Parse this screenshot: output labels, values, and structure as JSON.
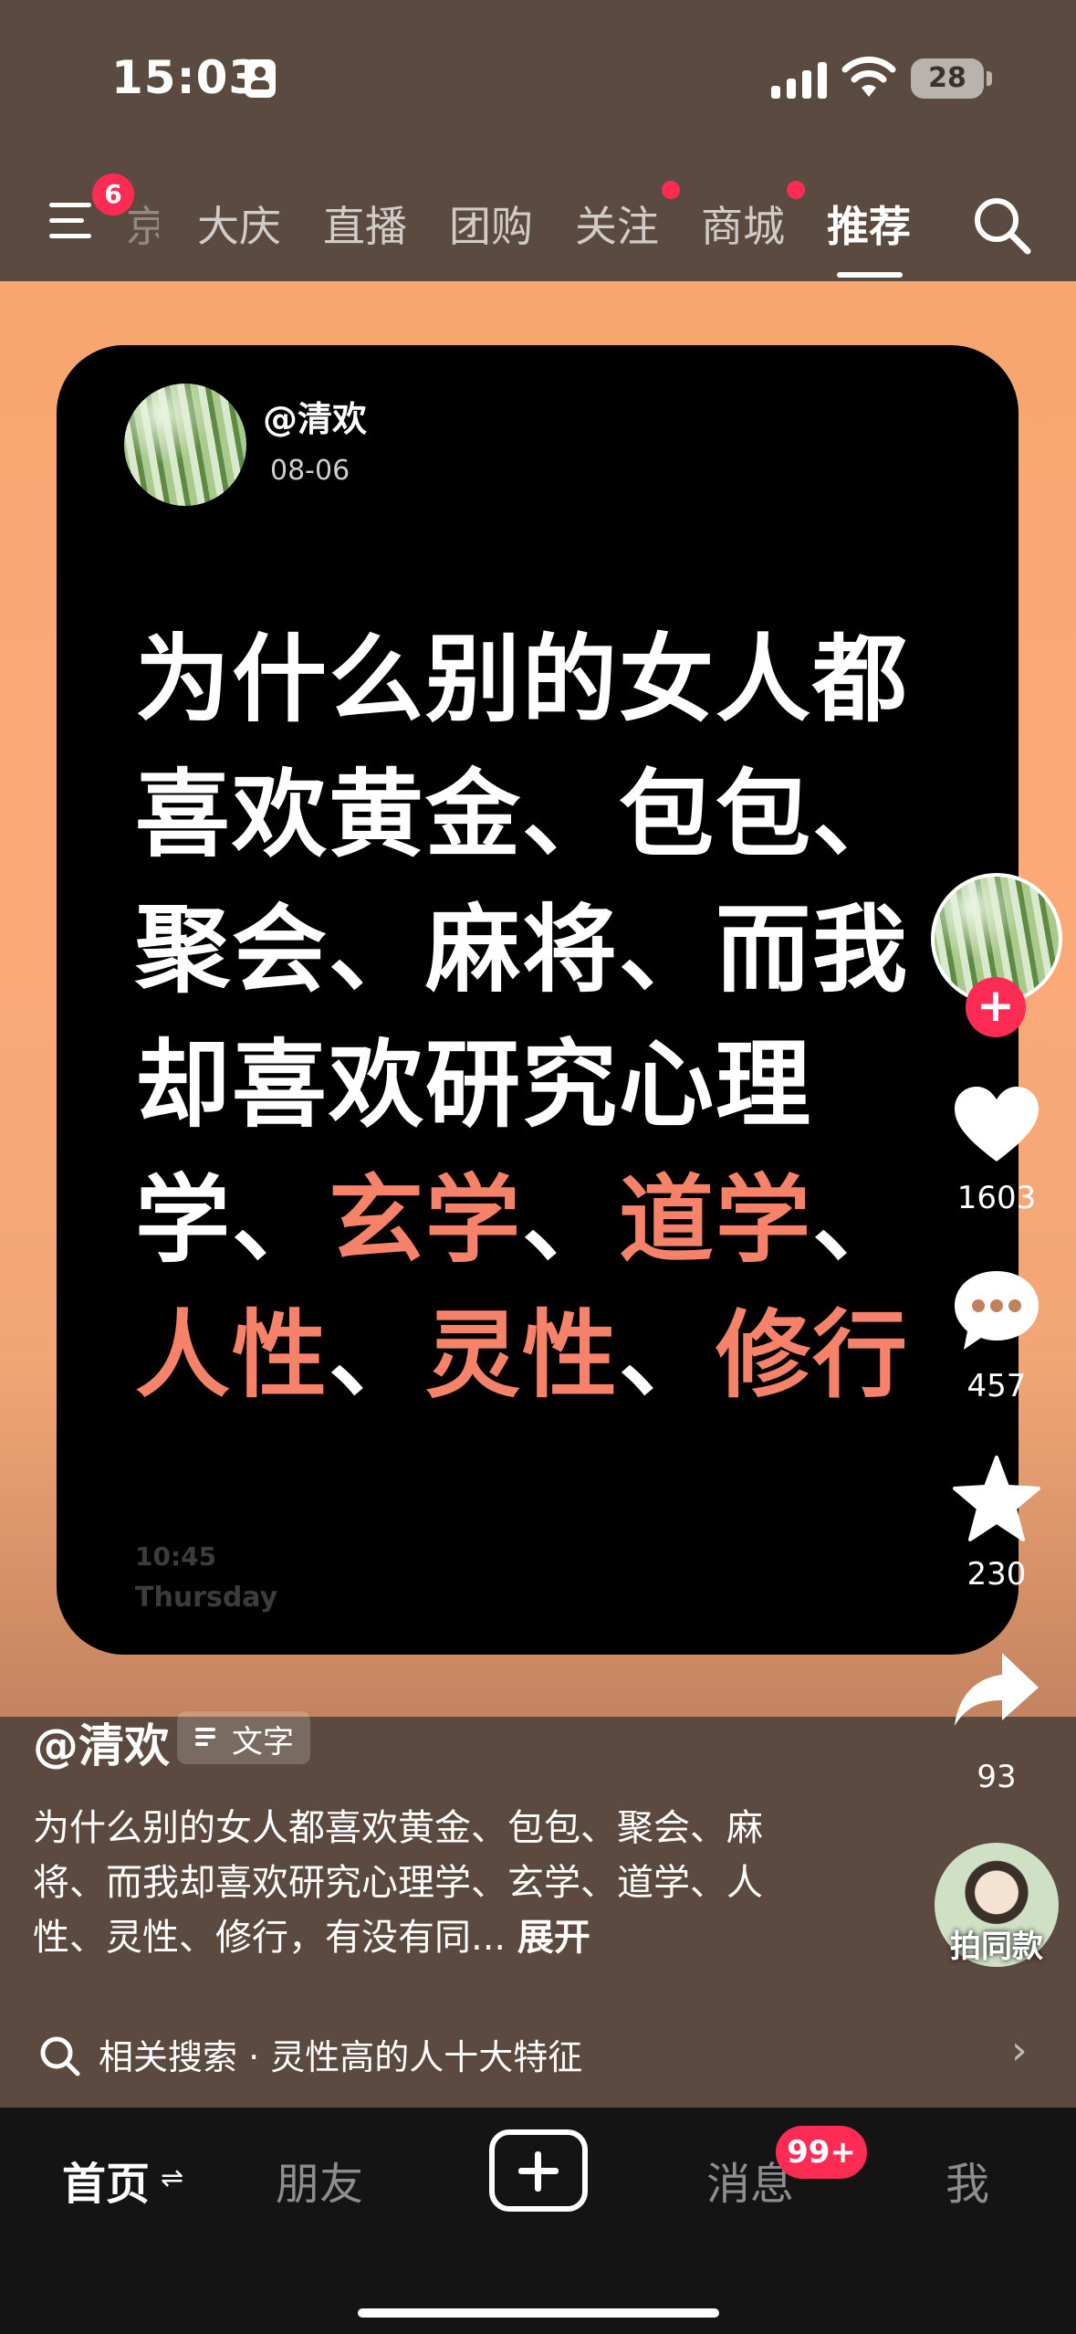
{
  "status_bar": {
    "time": "15:03",
    "battery": "28"
  },
  "top_nav": {
    "menu_badge": "6",
    "tabs": [
      {
        "label": "京",
        "faded": true
      },
      {
        "label": "大庆"
      },
      {
        "label": "直播"
      },
      {
        "label": "团购"
      },
      {
        "label": "关注",
        "dot": true
      },
      {
        "label": "商城",
        "dot": true
      },
      {
        "label": "推荐",
        "active": true
      }
    ]
  },
  "card": {
    "username": "@清欢",
    "date": "08-06",
    "lines": [
      [
        {
          "t": "为什么别的女人都"
        }
      ],
      [
        {
          "t": "喜欢黄金、包包、"
        }
      ],
      [
        {
          "t": "聚会、麻将、而我"
        }
      ],
      [
        {
          "t": "却喜欢研究心理"
        }
      ],
      [
        {
          "t": "学、"
        },
        {
          "t": "玄学",
          "hl": true
        },
        {
          "t": "、"
        },
        {
          "t": "道学",
          "hl": true
        },
        {
          "t": "、"
        }
      ],
      [
        {
          "t": "人性",
          "hl": true
        },
        {
          "t": "、"
        },
        {
          "t": "灵性",
          "hl": true
        },
        {
          "t": "、"
        },
        {
          "t": "修行",
          "hl": true
        }
      ]
    ],
    "time": "10:45",
    "day": "Thursday"
  },
  "actions": {
    "likes": "1603",
    "comments": "457",
    "favorites": "230",
    "shares": "93",
    "remix_label": "拍同款"
  },
  "post": {
    "author": "@清欢",
    "tag_label": "文字",
    "description": "为什么别的女人都喜欢黄金、包包、聚会、麻将、而我却喜欢研究心理学、玄学、道学、人性、灵性、修行，有没有同...",
    "expand_label": "展开"
  },
  "related_search": {
    "text": "相关搜索 · 灵性高的人十大特征"
  },
  "bottom_nav": {
    "home": "首页",
    "friends": "朋友",
    "messages": "消息",
    "messages_badge": "99+",
    "me": "我"
  },
  "colors": {
    "accent": "#fe2c55",
    "highlight": "#f6826a",
    "background": "#f8a66f"
  }
}
